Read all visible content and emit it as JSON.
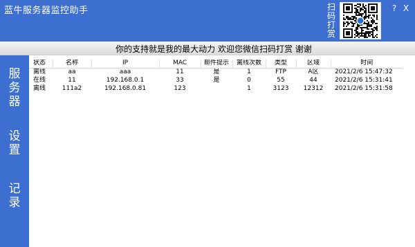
{
  "app": {
    "title": "蓝牛服务器监控助手",
    "scan_label": "扫码打赏",
    "help_label": "?",
    "close_label": "X",
    "brand_color": "#3c6fcf"
  },
  "banner": {
    "text": "你的支持就是我的最大动力   欢迎您微信扫码打赏 谢谢"
  },
  "sidebar": {
    "items": [
      {
        "label": "服务器"
      },
      {
        "label": "设置"
      },
      {
        "label": "记录"
      }
    ]
  },
  "table": {
    "columns": [
      "状态",
      "名称",
      "IP",
      "MAC",
      "邮件提示",
      "离线次数",
      "类型",
      "区域",
      "时间"
    ],
    "rows": [
      [
        "离线",
        "aa",
        "aaa",
        "11",
        "是",
        "1",
        "FTP",
        "A区",
        "2021/2/6 15:47:32"
      ],
      [
        "在线",
        "11",
        "192.168.0.1",
        "33",
        "是",
        "0",
        "55",
        "44",
        "2021/2/6 15:31:41"
      ],
      [
        "离线",
        "111a2",
        "192.168.0.81",
        "123",
        "",
        "1",
        "3123",
        "12312",
        "2021/2/6 15:31:58"
      ]
    ]
  }
}
